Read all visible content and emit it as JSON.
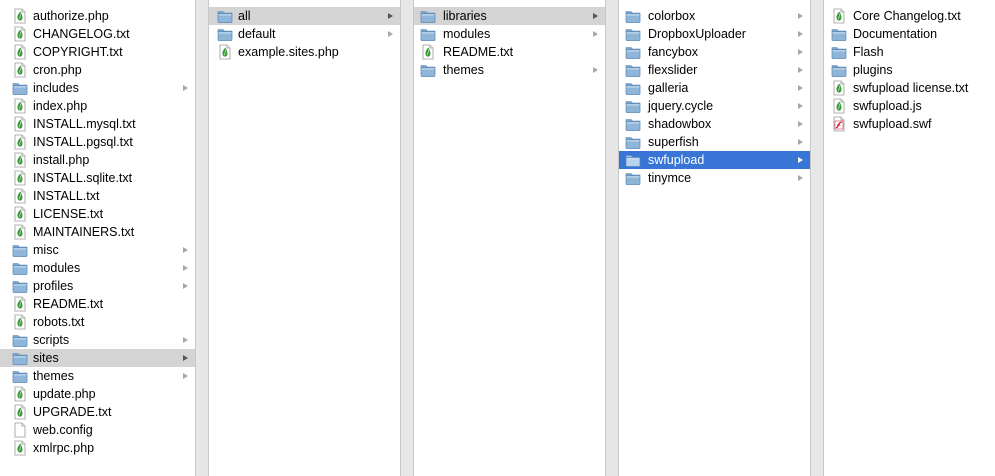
{
  "colors": {
    "selection_active": "#3875d7",
    "selection_inactive": "#d4d4d4",
    "folder_blue": "#8fb6d8",
    "leaf_green": "#3a9a3a"
  },
  "columns": [
    {
      "items": [
        {
          "label": "authorize.php",
          "icon": "drupal-file-icon",
          "folder": false,
          "selected": ""
        },
        {
          "label": "CHANGELOG.txt",
          "icon": "drupal-file-icon",
          "folder": false,
          "selected": ""
        },
        {
          "label": "COPYRIGHT.txt",
          "icon": "drupal-file-icon",
          "folder": false,
          "selected": ""
        },
        {
          "label": "cron.php",
          "icon": "drupal-file-icon",
          "folder": false,
          "selected": ""
        },
        {
          "label": "includes",
          "icon": "folder-icon",
          "folder": true,
          "selected": ""
        },
        {
          "label": "index.php",
          "icon": "drupal-file-icon",
          "folder": false,
          "selected": ""
        },
        {
          "label": "INSTALL.mysql.txt",
          "icon": "drupal-file-icon",
          "folder": false,
          "selected": ""
        },
        {
          "label": "INSTALL.pgsql.txt",
          "icon": "drupal-file-icon",
          "folder": false,
          "selected": ""
        },
        {
          "label": "install.php",
          "icon": "drupal-file-icon",
          "folder": false,
          "selected": ""
        },
        {
          "label": "INSTALL.sqlite.txt",
          "icon": "drupal-file-icon",
          "folder": false,
          "selected": ""
        },
        {
          "label": "INSTALL.txt",
          "icon": "drupal-file-icon",
          "folder": false,
          "selected": ""
        },
        {
          "label": "LICENSE.txt",
          "icon": "drupal-file-icon",
          "folder": false,
          "selected": ""
        },
        {
          "label": "MAINTAINERS.txt",
          "icon": "drupal-file-icon",
          "folder": false,
          "selected": ""
        },
        {
          "label": "misc",
          "icon": "folder-icon",
          "folder": true,
          "selected": ""
        },
        {
          "label": "modules",
          "icon": "folder-icon",
          "folder": true,
          "selected": ""
        },
        {
          "label": "profiles",
          "icon": "folder-icon",
          "folder": true,
          "selected": ""
        },
        {
          "label": "README.txt",
          "icon": "drupal-file-icon",
          "folder": false,
          "selected": ""
        },
        {
          "label": "robots.txt",
          "icon": "drupal-file-icon",
          "folder": false,
          "selected": ""
        },
        {
          "label": "scripts",
          "icon": "folder-icon",
          "folder": true,
          "selected": ""
        },
        {
          "label": "sites",
          "icon": "folder-icon",
          "folder": true,
          "selected": "gray"
        },
        {
          "label": "themes",
          "icon": "folder-icon",
          "folder": true,
          "selected": ""
        },
        {
          "label": "update.php",
          "icon": "drupal-file-icon",
          "folder": false,
          "selected": ""
        },
        {
          "label": "UPGRADE.txt",
          "icon": "drupal-file-icon",
          "folder": false,
          "selected": ""
        },
        {
          "label": "web.config",
          "icon": "blank-document-icon",
          "folder": false,
          "selected": ""
        },
        {
          "label": "xmlrpc.php",
          "icon": "drupal-file-icon",
          "folder": false,
          "selected": ""
        }
      ]
    },
    {
      "items": [
        {
          "label": "all",
          "icon": "folder-icon",
          "folder": true,
          "selected": "gray"
        },
        {
          "label": "default",
          "icon": "folder-icon",
          "folder": true,
          "selected": ""
        },
        {
          "label": "example.sites.php",
          "icon": "drupal-file-icon",
          "folder": false,
          "selected": ""
        }
      ]
    },
    {
      "items": [
        {
          "label": "libraries",
          "icon": "folder-icon",
          "folder": true,
          "selected": "gray"
        },
        {
          "label": "modules",
          "icon": "folder-icon",
          "folder": true,
          "selected": ""
        },
        {
          "label": "README.txt",
          "icon": "drupal-file-icon",
          "folder": false,
          "selected": ""
        },
        {
          "label": "themes",
          "icon": "folder-icon",
          "folder": true,
          "selected": ""
        }
      ]
    },
    {
      "items": [
        {
          "label": "colorbox",
          "icon": "folder-icon",
          "folder": true,
          "selected": ""
        },
        {
          "label": "DropboxUploader",
          "icon": "folder-icon",
          "folder": true,
          "selected": ""
        },
        {
          "label": "fancybox",
          "icon": "folder-icon",
          "folder": true,
          "selected": ""
        },
        {
          "label": "flexslider",
          "icon": "folder-icon",
          "folder": true,
          "selected": ""
        },
        {
          "label": "galleria",
          "icon": "folder-icon",
          "folder": true,
          "selected": ""
        },
        {
          "label": "jquery.cycle",
          "icon": "folder-icon",
          "folder": true,
          "selected": ""
        },
        {
          "label": "shadowbox",
          "icon": "folder-icon",
          "folder": true,
          "selected": ""
        },
        {
          "label": "superfish",
          "icon": "folder-icon",
          "folder": true,
          "selected": ""
        },
        {
          "label": "swfupload",
          "icon": "folder-icon",
          "folder": true,
          "selected": "blue"
        },
        {
          "label": "tinymce",
          "icon": "folder-icon",
          "folder": true,
          "selected": ""
        }
      ]
    },
    {
      "items": [
        {
          "label": "Core Changelog.txt",
          "icon": "drupal-file-icon",
          "folder": false,
          "selected": ""
        },
        {
          "label": "Documentation",
          "icon": "folder-icon",
          "folder": false,
          "selected": ""
        },
        {
          "label": "Flash",
          "icon": "folder-icon",
          "folder": false,
          "selected": ""
        },
        {
          "label": "plugins",
          "icon": "folder-icon",
          "folder": false,
          "selected": ""
        },
        {
          "label": "swfupload license.txt",
          "icon": "drupal-file-icon",
          "folder": false,
          "selected": ""
        },
        {
          "label": "swfupload.js",
          "icon": "drupal-file-icon",
          "folder": false,
          "selected": ""
        },
        {
          "label": "swfupload.swf",
          "icon": "flash-file-icon",
          "folder": false,
          "selected": ""
        }
      ]
    }
  ]
}
